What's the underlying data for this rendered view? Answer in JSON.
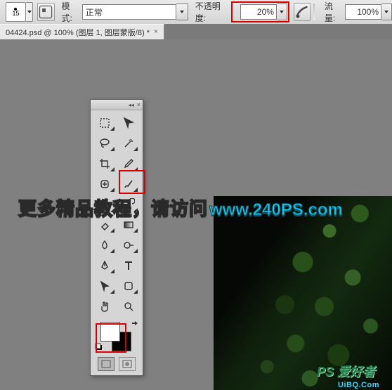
{
  "options_bar": {
    "brush_size": "15",
    "mode_label": "模式:",
    "mode_value": "正常",
    "opacity_label": "不透明度:",
    "opacity_value": "20%",
    "flow_label": "流量:",
    "flow_value": "100%"
  },
  "doc_tab": {
    "title": "04424.psd @ 100% (图层 1, 图层蒙版/8) *"
  },
  "tools_panel": {
    "header_collapse": "◂◂",
    "header_close": "×"
  },
  "promo": {
    "cn_text": "更多精品教程，请访问",
    "url_text": "www.240PS.com"
  },
  "watermark": {
    "line1": "PS 爱好者",
    "line2": "UiBQ.Com"
  },
  "colors": {
    "highlight": "#d00",
    "accent": "#19c7ec"
  }
}
